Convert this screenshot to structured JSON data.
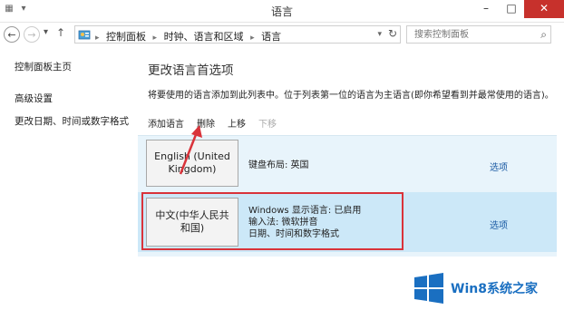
{
  "window": {
    "title": "语言"
  },
  "nav": {
    "back": "←",
    "forward": "→",
    "recent": "▾",
    "up": "↑",
    "breadcrumbs": [
      "控制面板",
      "时钟、语言和区域",
      "语言"
    ],
    "dropdown": "▾",
    "refresh": "↻",
    "search_placeholder": "搜索控制面板",
    "search_icon": "⌕"
  },
  "window_buttons": {
    "minimize": "–",
    "maximize": "□",
    "close": "✕"
  },
  "sidebar": {
    "home": "控制面板主页",
    "items": [
      "高级设置",
      "更改日期、时间或数字格式"
    ]
  },
  "main": {
    "title": "更改语言首选项",
    "description": "将要使用的语言添加到此列表中。位于列表第一位的语言为主语言(即你希望看到并最常使用的语言)。",
    "toolbar": {
      "add": "添加语言",
      "delete": "删除",
      "up": "上移",
      "down": "下移"
    },
    "languages": [
      {
        "name": "English (United Kingdom)",
        "line1": "键盘布局: 英国",
        "line2": "",
        "line3": "",
        "options": "选项"
      },
      {
        "name": "中文(中华人民共和国)",
        "line1": "Windows 显示语言: 已启用",
        "line2": "输入法: 微软拼音",
        "line3": "日期、时间和数字格式",
        "options": "选项"
      }
    ]
  },
  "watermark": {
    "text": "Win8系统之家"
  },
  "colors": {
    "highlight": "#d9333a",
    "selected_row": "#cce8f8",
    "list_bg": "#e8f4fb",
    "link": "#1a5aa3",
    "logo": "#1a6fc1"
  }
}
